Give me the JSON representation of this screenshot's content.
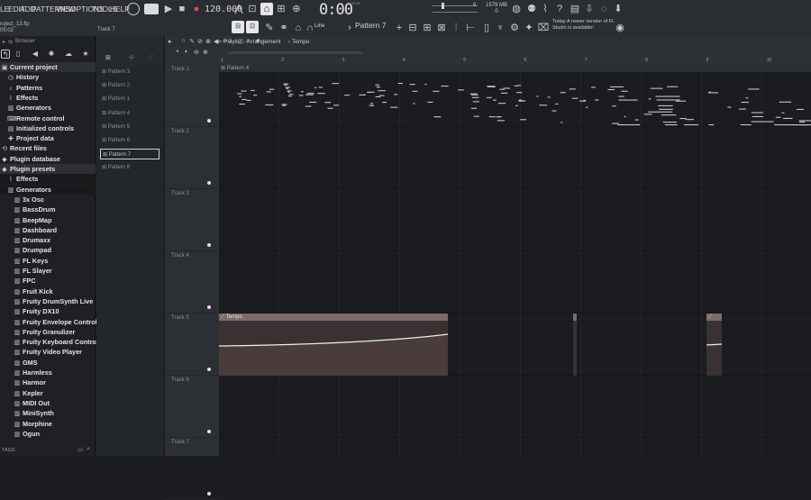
{
  "menu": [
    "LE",
    "EDIT",
    "ADD",
    "PATTERNS",
    "VIEW",
    "OPTIONS",
    "TOOLS",
    "HELP"
  ],
  "project": {
    "name": "roject_13.flp",
    "time": "05:02"
  },
  "transport": {
    "bpm": "120.000",
    "time": "0:00",
    "time_sub": "00",
    "mcs": "M:S:CS",
    "pattern": "Pattern 7",
    "snap_mode": "Line",
    "track_hint": "Track 7"
  },
  "memory": {
    "cpu": "6",
    "mb": "1579 MB",
    "poly": "0"
  },
  "news": {
    "day": "Today",
    "text": "A newer version of FL Studio is available!"
  },
  "browser": {
    "title": "Browser",
    "items": [
      {
        "label": "Current project",
        "icon": "folder-icon",
        "indent": 0
      },
      {
        "label": "History",
        "icon": "history-icon",
        "indent": 1
      },
      {
        "label": "Patterns",
        "icon": "note-icon",
        "indent": 1
      },
      {
        "label": "Effects",
        "icon": "plug-icon",
        "indent": 1
      },
      {
        "label": "Generators",
        "icon": "piano-icon",
        "indent": 1
      },
      {
        "label": "Remote control",
        "icon": "remote-icon",
        "indent": 1
      },
      {
        "label": "Initialized controls",
        "icon": "controls-icon",
        "indent": 1
      },
      {
        "label": "Project data",
        "icon": "data-icon",
        "indent": 1
      },
      {
        "label": "Recent files",
        "icon": "recent-icon",
        "indent": 0
      },
      {
        "label": "Plugin database",
        "icon": "database-icon",
        "indent": 0
      },
      {
        "label": "Plugin presets",
        "icon": "presets-icon",
        "indent": 0
      },
      {
        "label": "Effects",
        "icon": "plug-icon",
        "indent": 1
      },
      {
        "label": "Generators",
        "icon": "piano-icon",
        "indent": 1
      },
      {
        "label": "3x Osc",
        "icon": "piano-icon",
        "indent": 2
      },
      {
        "label": "BassDrum",
        "icon": "piano-icon",
        "indent": 2
      },
      {
        "label": "BeepMap",
        "icon": "piano-icon",
        "indent": 2
      },
      {
        "label": "Dashboard",
        "icon": "piano-icon",
        "indent": 2
      },
      {
        "label": "Drumaxx",
        "icon": "piano-icon",
        "indent": 2
      },
      {
        "label": "Drumpad",
        "icon": "piano-icon",
        "indent": 2
      },
      {
        "label": "FL Keys",
        "icon": "piano-icon",
        "indent": 2
      },
      {
        "label": "FL Slayer",
        "icon": "piano-icon",
        "indent": 2
      },
      {
        "label": "FPC",
        "icon": "piano-icon",
        "indent": 2
      },
      {
        "label": "Fruit Kick",
        "icon": "piano-icon",
        "indent": 2
      },
      {
        "label": "Fruity DrumSynth Live",
        "icon": "piano-icon",
        "indent": 2
      },
      {
        "label": "Fruity DX10",
        "icon": "piano-icon",
        "indent": 2
      },
      {
        "label": "Fruity Envelope Controller",
        "icon": "piano-icon",
        "indent": 2
      },
      {
        "label": "Fruity Granulizer",
        "icon": "piano-icon",
        "indent": 2
      },
      {
        "label": "Fruity Keyboard Controller",
        "icon": "piano-icon",
        "indent": 2
      },
      {
        "label": "Fruity Video Player",
        "icon": "piano-icon",
        "indent": 2
      },
      {
        "label": "GMS",
        "icon": "piano-icon",
        "indent": 2
      },
      {
        "label": "Harmless",
        "icon": "piano-icon",
        "indent": 2
      },
      {
        "label": "Harmor",
        "icon": "piano-icon",
        "indent": 2
      },
      {
        "label": "Kepler",
        "icon": "piano-icon",
        "indent": 2
      },
      {
        "label": "MIDI Out",
        "icon": "piano-icon",
        "indent": 2
      },
      {
        "label": "MiniSynth",
        "icon": "piano-icon",
        "indent": 2
      },
      {
        "label": "Morphine",
        "icon": "piano-icon",
        "indent": 2
      },
      {
        "label": "Ogun",
        "icon": "piano-icon",
        "indent": 2
      }
    ],
    "tags_label": "TAGS"
  },
  "patterns": [
    "Pattern 3",
    "Pattern 2",
    "Pattern 1",
    "Pattern 4",
    "Pattern 5",
    "Pattern 6",
    "Pattern 7",
    "Pattern 8"
  ],
  "selected_pattern_index": 6,
  "playlist": {
    "title": "Playlist - Arrangement",
    "breadcrumb": "Tempo",
    "bars": [
      "1",
      "2",
      "3",
      "4",
      "5",
      "6",
      "7",
      "8",
      "9",
      "10"
    ],
    "tracks": [
      "Track 1",
      "Track 2",
      "Track 3",
      "Track 4",
      "Track 5",
      "Track 6",
      "Track 7"
    ],
    "clips": {
      "pattern4": "Pattern 4",
      "tempo": "Tempo"
    }
  },
  "colors": {
    "clip_tempo": "#7d6b64",
    "accent": "#e24a4a"
  }
}
